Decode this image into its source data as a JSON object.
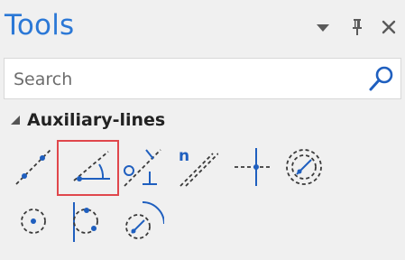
{
  "panel": {
    "title": "Tools"
  },
  "search": {
    "placeholder": "Search",
    "value": ""
  },
  "section": {
    "label": "Auxiliary-lines",
    "expanded": true
  },
  "tools": [
    {
      "name": "line-through-two-points-icon"
    },
    {
      "name": "line-at-angle-icon",
      "highlighted": true
    },
    {
      "name": "perpendicular-line-icon"
    },
    {
      "name": "parallel-lines-icon",
      "label": "n"
    },
    {
      "name": "crosshair-lines-icon"
    },
    {
      "name": "circle-center-line-icon"
    },
    {
      "name": "circle-through-point-icon"
    },
    {
      "name": "circle-tangent-line-icon"
    },
    {
      "name": "circle-tangent-arc-icon"
    }
  ],
  "colors": {
    "title": "#2b78d6",
    "icon_blue": "#1f5fbf",
    "icon_dark": "#3a3a3a",
    "highlight": "#e0474c"
  }
}
